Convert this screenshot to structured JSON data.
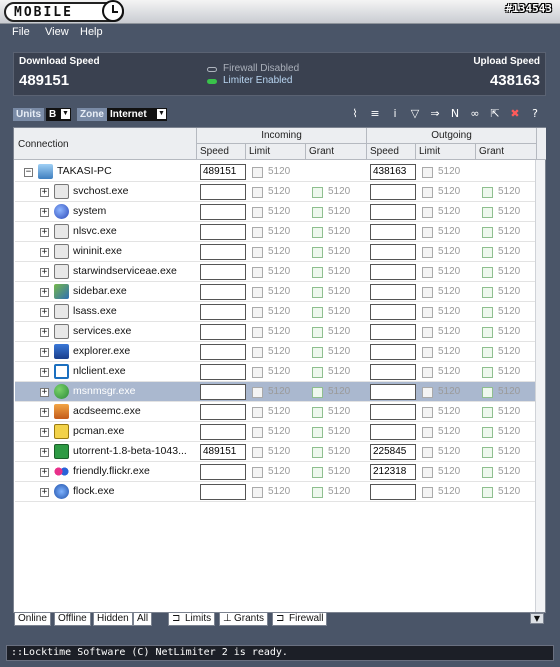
{
  "window": {
    "title": "MOBILE",
    "id_label": "#134543"
  },
  "menu": [
    "File",
    "View",
    "Help"
  ],
  "stats": {
    "download_label": "Download Speed",
    "download_value": "489151",
    "upload_label": "Upload Speed",
    "upload_value": "438163",
    "firewall_status": "Firewall Disabled",
    "limiter_status": "Limiter Enabled"
  },
  "toolbar": {
    "units_label": "Units",
    "units_value": "B",
    "zone_label": "Zone",
    "zone_value": "Internet"
  },
  "table": {
    "col_connection": "Connection",
    "group_incoming": "Incoming",
    "group_outgoing": "Outgoing",
    "col_speed": "Speed",
    "col_limit": "Limit",
    "col_grant": "Grant",
    "root": {
      "name": "TAKASI-PC",
      "in_speed": "489151",
      "in_limit": "5120",
      "out_speed": "438163",
      "out_limit": "5120"
    },
    "rows": [
      {
        "name": "svchost.exe",
        "in_speed": "",
        "in_limit": "5120",
        "in_grant": "5120",
        "out_speed": "",
        "out_limit": "5120",
        "out_grant": "5120"
      },
      {
        "name": "system",
        "in_speed": "",
        "in_limit": "5120",
        "in_grant": "5120",
        "out_speed": "",
        "out_limit": "5120",
        "out_grant": "5120"
      },
      {
        "name": "nlsvc.exe",
        "in_speed": "",
        "in_limit": "5120",
        "in_grant": "5120",
        "out_speed": "",
        "out_limit": "5120",
        "out_grant": "5120"
      },
      {
        "name": "wininit.exe",
        "in_speed": "",
        "in_limit": "5120",
        "in_grant": "5120",
        "out_speed": "",
        "out_limit": "5120",
        "out_grant": "5120"
      },
      {
        "name": "starwindserviceae.exe",
        "in_speed": "",
        "in_limit": "5120",
        "in_grant": "5120",
        "out_speed": "",
        "out_limit": "5120",
        "out_grant": "5120"
      },
      {
        "name": "sidebar.exe",
        "in_speed": "",
        "in_limit": "5120",
        "in_grant": "5120",
        "out_speed": "",
        "out_limit": "5120",
        "out_grant": "5120"
      },
      {
        "name": "lsass.exe",
        "in_speed": "",
        "in_limit": "5120",
        "in_grant": "5120",
        "out_speed": "",
        "out_limit": "5120",
        "out_grant": "5120"
      },
      {
        "name": "services.exe",
        "in_speed": "",
        "in_limit": "5120",
        "in_grant": "5120",
        "out_speed": "",
        "out_limit": "5120",
        "out_grant": "5120"
      },
      {
        "name": "explorer.exe",
        "in_speed": "",
        "in_limit": "5120",
        "in_grant": "5120",
        "out_speed": "",
        "out_limit": "5120",
        "out_grant": "5120"
      },
      {
        "name": "nlclient.exe",
        "in_speed": "",
        "in_limit": "5120",
        "in_grant": "5120",
        "out_speed": "",
        "out_limit": "5120",
        "out_grant": "5120"
      },
      {
        "name": "msnmsgr.exe",
        "in_speed": "",
        "in_limit": "5120",
        "in_grant": "5120",
        "out_speed": "",
        "out_limit": "5120",
        "out_grant": "5120"
      },
      {
        "name": "acdseemc.exe",
        "in_speed": "",
        "in_limit": "5120",
        "in_grant": "5120",
        "out_speed": "",
        "out_limit": "5120",
        "out_grant": "5120"
      },
      {
        "name": "pcman.exe",
        "in_speed": "",
        "in_limit": "5120",
        "in_grant": "5120",
        "out_speed": "",
        "out_limit": "5120",
        "out_grant": "5120"
      },
      {
        "name": "utorrent-1.8-beta-1043...",
        "in_speed": "489151",
        "in_limit": "5120",
        "in_grant": "5120",
        "out_speed": "225845",
        "out_limit": "5120",
        "out_grant": "5120"
      },
      {
        "name": "friendly.flickr.exe",
        "in_speed": "",
        "in_limit": "5120",
        "in_grant": "5120",
        "out_speed": "212318",
        "out_limit": "5120",
        "out_grant": "5120"
      },
      {
        "name": "flock.exe",
        "in_speed": "",
        "in_limit": "5120",
        "in_grant": "5120",
        "out_speed": "",
        "out_limit": "5120",
        "out_grant": "5120"
      }
    ]
  },
  "bottom_tabs": {
    "online": "Online",
    "offline": "Offline",
    "hidden": "Hidden",
    "all": "All"
  },
  "view_tabs": {
    "limits": "Limits",
    "grants": "Grants",
    "firewall": "Firewall"
  },
  "status": "::Locktime Software (C) NetLimiter 2 is ready.",
  "colors": {
    "accent": "#4a5568",
    "selected_row": "#aab8cf",
    "firewall_led": "#9aa3ad",
    "limiter_led": "#39c24a"
  }
}
